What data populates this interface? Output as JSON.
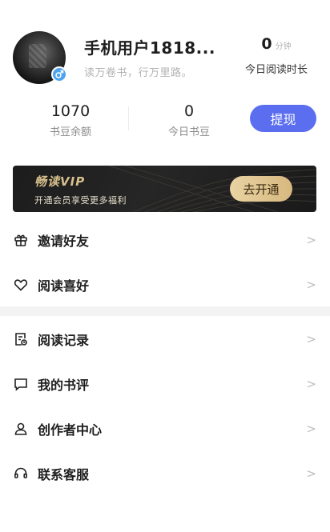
{
  "profile": {
    "username": "手机用户1818...",
    "motto": "读万卷书，行万里路。"
  },
  "today_read": {
    "value": "0",
    "unit": "分钟",
    "label": "今日阅读时长"
  },
  "stats": {
    "balance_value": "1070",
    "balance_label": "书豆余额",
    "today_value": "0",
    "today_label": "今日书豆",
    "withdraw_label": "提现"
  },
  "vip": {
    "title": "畅读VIP",
    "desc": "开通会员享受更多福利",
    "button": "去开通"
  },
  "menu": [
    {
      "label": "邀请好友",
      "icon": "gift-icon"
    },
    {
      "label": "阅读喜好",
      "icon": "heart-icon"
    },
    {
      "label": "阅读记录",
      "icon": "history-icon"
    },
    {
      "label": "我的书评",
      "icon": "comment-icon"
    },
    {
      "label": "创作者中心",
      "icon": "user-icon"
    },
    {
      "label": "联系客服",
      "icon": "headset-icon"
    }
  ],
  "arrow": ">",
  "colors": {
    "accent": "#5b6ef0",
    "vip_gold": "#d7bf8c",
    "badge_blue": "#4ea3f0"
  }
}
